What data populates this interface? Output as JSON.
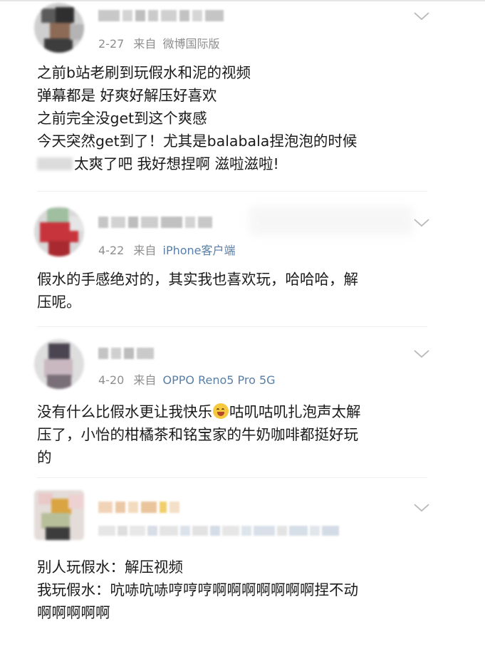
{
  "comments": [
    {
      "date": "2-27",
      "from_label": "来自",
      "source": "微博国际版",
      "lines": [
        "之前b站老刷到玩假水和泥的视频",
        "弹幕都是 好爽好解压好喜欢",
        "之前完全没get到这个爽感",
        "今天突然get到了！尤其是balabala捏泡泡的时候"
      ],
      "last_line_after_blur": "太爽了吧 我好想捏啊 滋啦滋啦!"
    },
    {
      "date": "4-22",
      "from_label": "来自",
      "source": "iPhone客户端",
      "lines": [
        "假水的手感绝对的，其实我也喜欢玩，哈哈哈，解",
        "压呢。"
      ]
    },
    {
      "date": "4-20",
      "from_label": "来自",
      "source": "OPPO Reno5 Pro 5G",
      "line1_before_emoji": "没有什么比假水更让我快乐",
      "line1_after_emoji": "咕叽咕叽扎泡声太解",
      "lines": [
        "压了，小怡的柑橘茶和铭宝家的牛奶咖啡都挺好玩",
        "的"
      ]
    },
    {
      "lines": [
        "别人玩假水：解压视频",
        "我玩假水：吭哧吭哧哼哼哼啊啊啊啊啊啊啊捏不动",
        "啊啊啊啊啊"
      ]
    }
  ],
  "icons": {
    "chevron": "chevron-down-icon",
    "emoji": "smiling-face-emoji"
  },
  "colors": {
    "source_link": "#5a7fa6",
    "meta": "#8e8e8e",
    "text": "#1a1a1a"
  }
}
